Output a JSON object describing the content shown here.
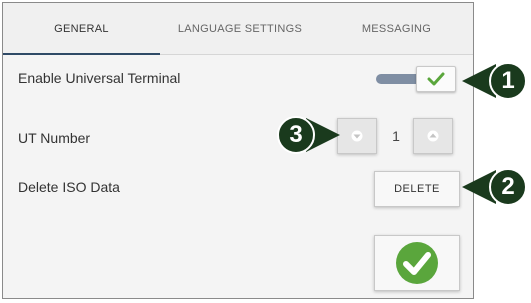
{
  "tabs": [
    {
      "label": "GENERAL",
      "active": true
    },
    {
      "label": "LANGUAGE SETTINGS",
      "active": false
    },
    {
      "label": "MESSAGING",
      "active": false
    }
  ],
  "settings": {
    "universal_terminal_label": "Enable Universal Terminal",
    "universal_terminal_enabled": true,
    "ut_number_label": "UT Number",
    "ut_number_value": "1",
    "delete_iso_label": "Delete ISO Data",
    "delete_button_label": "DELETE"
  },
  "callouts": {
    "toggle": "1",
    "delete": "2",
    "stepper": "3"
  },
  "colors": {
    "accent_underline": "#2f4a66",
    "check_green": "#5aa63c",
    "callout_dark": "#1a3a1d"
  },
  "icons": {
    "toggle_knob": "checkmark-icon",
    "stepper_down": "chevron-down-icon",
    "stepper_up": "chevron-up-icon",
    "confirm": "confirm-check-icon"
  }
}
